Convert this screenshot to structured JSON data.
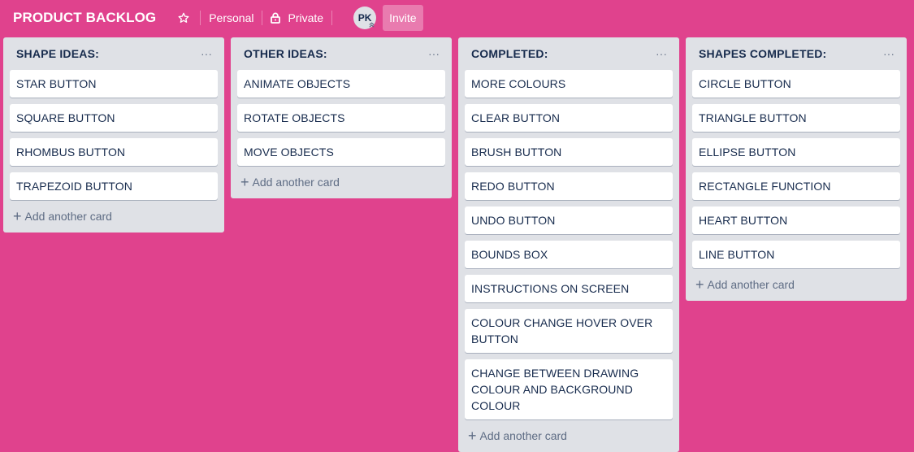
{
  "header": {
    "title": "PRODUCT BACKLOG",
    "star_icon": "star-icon",
    "team_label": "Personal",
    "visibility_label": "Private",
    "visibility_icon": "lock-icon",
    "avatar_initials": "PK",
    "invite_label": "Invite"
  },
  "colors": {
    "background": "#e0428d",
    "list_bg": "#dfe1e6",
    "card_bg": "#ffffff",
    "text": "#172b4d"
  },
  "lists": [
    {
      "title": "SHAPE IDEAS:",
      "menu": "···",
      "cards": [
        "STAR BUTTON",
        "SQUARE BUTTON",
        "RHOMBUS BUTTON",
        "TRAPEZOID BUTTON"
      ],
      "add_label": "Add another card"
    },
    {
      "title": "OTHER IDEAS:",
      "menu": "···",
      "cards": [
        "ANIMATE OBJECTS",
        "ROTATE OBJECTS",
        "MOVE OBJECTS"
      ],
      "add_label": "Add another card"
    },
    {
      "title": "COMPLETED:",
      "menu": "···",
      "cards": [
        "MORE COLOURS",
        "CLEAR BUTTON",
        "BRUSH BUTTON",
        "REDO BUTTON",
        "UNDO BUTTON",
        "BOUNDS BOX",
        "INSTRUCTIONS ON SCREEN",
        "COLOUR CHANGE HOVER OVER BUTTON",
        "CHANGE BETWEEN DRAWING COLOUR AND BACKGROUND COLOUR"
      ],
      "add_label": "Add another card"
    },
    {
      "title": "SHAPES COMPLETED:",
      "menu": "···",
      "cards": [
        "CIRCLE BUTTON",
        "TRIANGLE BUTTON",
        "ELLIPSE BUTTON",
        "RECTANGLE FUNCTION",
        "HEART BUTTON",
        "LINE BUTTON"
      ],
      "add_label": "Add another card"
    }
  ]
}
